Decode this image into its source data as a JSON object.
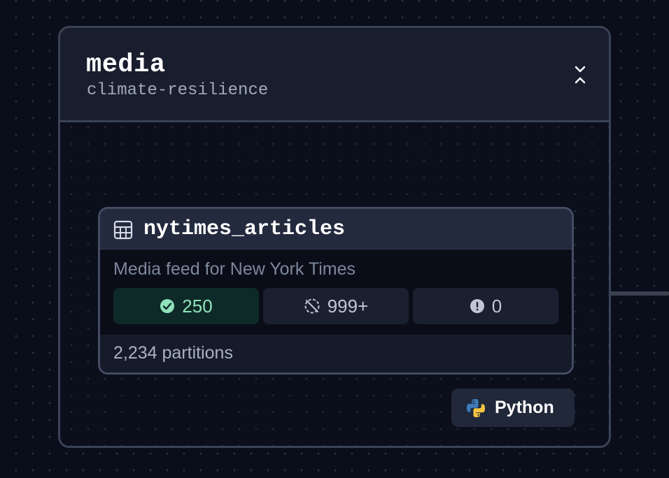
{
  "group": {
    "title": "media",
    "subtitle": "climate-resilience"
  },
  "asset": {
    "name": "nytimes_articles",
    "description": "Media feed for New York Times",
    "stats": {
      "materialized": "250",
      "missing": "999+",
      "failed": "0"
    },
    "partitions": "2,234 partitions"
  },
  "kind_tag": {
    "label": "Python"
  },
  "colors": {
    "background": "#0a0d1a",
    "success": "#8ee3bb",
    "border": "#3a4356"
  },
  "icons": {
    "collapse": "chevron-collapse-icon",
    "asset": "table-icon",
    "materialized": "check-circle-icon",
    "missing": "missing-circle-icon",
    "failed": "alert-circle-icon",
    "kind": "python-logo-icon"
  }
}
